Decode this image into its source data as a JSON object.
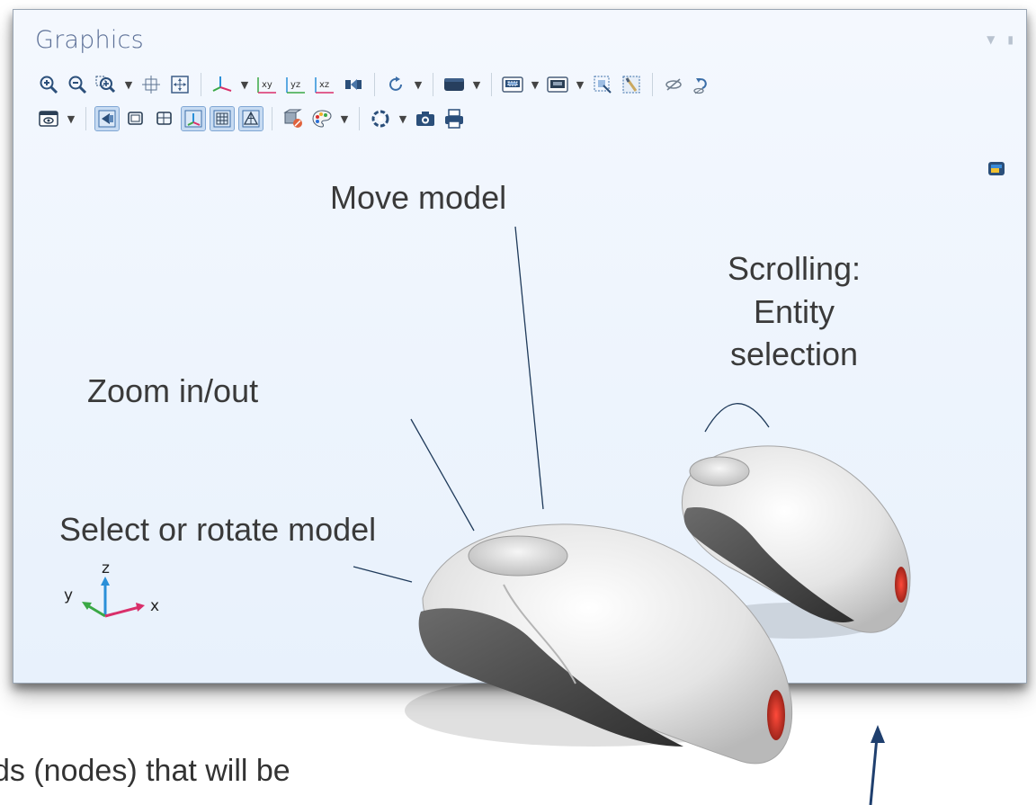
{
  "panel": {
    "title": "Graphics",
    "controls": [
      "dropdown-icon",
      "pin-icon"
    ]
  },
  "toolbar": {
    "row1": [
      "zoom-in-icon",
      "zoom-out-icon",
      "zoom-box-icon",
      "zoom-box-dropdown",
      "zoom-extents-icon",
      "zoom-to-selection-icon",
      "view-axis-icon",
      "view-axis-dropdown",
      "view-xy-icon",
      "view-yz-icon",
      "view-xz-icon",
      "camera-view-icon",
      "rotate-icon",
      "rotate-dropdown",
      "render-style-icon",
      "render-style-dropdown",
      "select-box-icon",
      "select-box-dropdown",
      "deselect-box-icon",
      "deselect-box-dropdown",
      "zoom-selection-icon",
      "select-all-icon",
      "hide-icon",
      "reset-hiding-icon"
    ],
    "row2": [
      "view-settings-icon",
      "view-settings-dropdown",
      "transparency-icon",
      "wireframe-icon",
      "scene-light-icon",
      "show-grid-icon",
      "show-axis-icon",
      "mesh-rendering-icon",
      "delete-view-icon",
      "color-palette-icon",
      "color-palette-dropdown",
      "render-icon",
      "render-dropdown",
      "snapshot-icon",
      "print-icon"
    ],
    "view_axis_labels": {
      "xy": "xy",
      "yz": "yz",
      "xz": "xz"
    }
  },
  "annotations": {
    "move_model": "Move model",
    "zoom": "Zoom in/out",
    "select_rotate": "Select or rotate model",
    "scroll_line1": "Scrolling:",
    "scroll_line2": "Entity",
    "scroll_line3": "selection"
  },
  "triad": {
    "x": "x",
    "y": "y",
    "z": "z"
  },
  "bottom_text": "ds (nodes) that will be",
  "colors": {
    "panel_bg": "#eef4fc",
    "title": "#5b6f96",
    "callout_line": "#1f3a5a",
    "arrow": "#1f3f6e"
  }
}
